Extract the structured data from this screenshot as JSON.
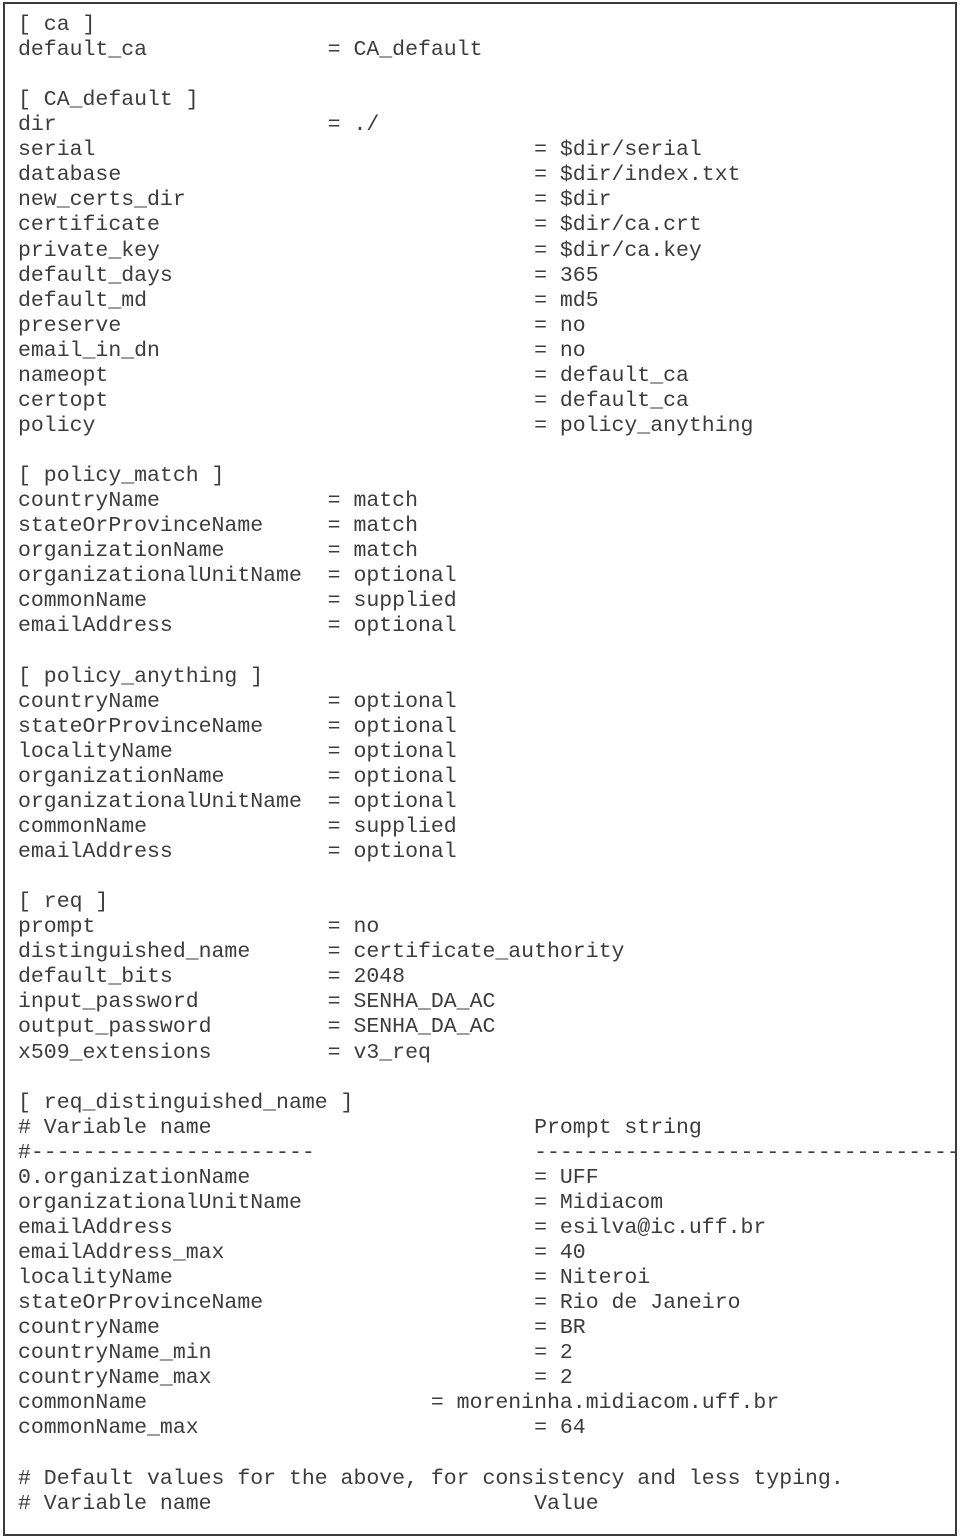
{
  "document": {
    "kind": "openssl-configuration-file-listing",
    "frame_border_color": "#3a3a3a",
    "text_color": "#3c3c3c",
    "background_color": "#ffffff",
    "font_style": "monospace",
    "char_columns": 64,
    "sections": [
      {
        "header": "[ ca ]",
        "entries": [
          {
            "key": "default_ca",
            "eq_column": 24,
            "value": "CA_default"
          }
        ]
      },
      {
        "header": "[ CA_default ]",
        "entries": [
          {
            "key": "dir",
            "eq_column": 24,
            "value": "./"
          },
          {
            "key": "serial",
            "eq_column": 40,
            "value": "$dir/serial"
          },
          {
            "key": "database",
            "eq_column": 40,
            "value": "$dir/index.txt"
          },
          {
            "key": "new_certs_dir",
            "eq_column": 40,
            "value": "$dir"
          },
          {
            "key": "certificate",
            "eq_column": 40,
            "value": "$dir/ca.crt"
          },
          {
            "key": "private_key",
            "eq_column": 40,
            "value": "$dir/ca.key"
          },
          {
            "key": "default_days",
            "eq_column": 40,
            "value": "365"
          },
          {
            "key": "default_md",
            "eq_column": 40,
            "value": "md5"
          },
          {
            "key": "preserve",
            "eq_column": 40,
            "value": "no"
          },
          {
            "key": "email_in_dn",
            "eq_column": 40,
            "value": "no"
          },
          {
            "key": "nameopt",
            "eq_column": 40,
            "value": "default_ca"
          },
          {
            "key": "certopt",
            "eq_column": 40,
            "value": "default_ca"
          },
          {
            "key": "policy",
            "eq_column": 40,
            "value": "policy_anything"
          }
        ]
      },
      {
        "header": "[ policy_match ]",
        "entries": [
          {
            "key": "countryName",
            "eq_column": 24,
            "value": "match"
          },
          {
            "key": "stateOrProvinceName",
            "eq_column": 24,
            "value": "match"
          },
          {
            "key": "organizationName",
            "eq_column": 24,
            "value": "match"
          },
          {
            "key": "organizationalUnitName",
            "eq_column": 24,
            "value": "optional"
          },
          {
            "key": "commonName",
            "eq_column": 24,
            "value": "supplied"
          },
          {
            "key": "emailAddress",
            "eq_column": 24,
            "value": "optional"
          }
        ]
      },
      {
        "header": "[ policy_anything ]",
        "entries": [
          {
            "key": "countryName",
            "eq_column": 24,
            "value": "optional"
          },
          {
            "key": "stateOrProvinceName",
            "eq_column": 24,
            "value": "optional"
          },
          {
            "key": "localityName",
            "eq_column": 24,
            "value": "optional"
          },
          {
            "key": "organizationName",
            "eq_column": 24,
            "value": "optional"
          },
          {
            "key": "organizationalUnitName",
            "eq_column": 24,
            "value": "optional"
          },
          {
            "key": "commonName",
            "eq_column": 24,
            "value": "supplied"
          },
          {
            "key": "emailAddress",
            "eq_column": 24,
            "value": "optional"
          }
        ]
      },
      {
        "header": "[ req ]",
        "entries": [
          {
            "key": "prompt",
            "eq_column": 24,
            "value": "no"
          },
          {
            "key": "distinguished_name",
            "eq_column": 24,
            "value": "certificate_authority"
          },
          {
            "key": "default_bits",
            "eq_column": 24,
            "value": "2048"
          },
          {
            "key": "input_password",
            "eq_column": 24,
            "value": "SENHA_DA_AC"
          },
          {
            "key": "output_password",
            "eq_column": 24,
            "value": "SENHA_DA_AC"
          },
          {
            "key": "x509_extensions",
            "eq_column": 24,
            "value": "v3_req"
          }
        ]
      },
      {
        "header": "[ req_distinguished_name ]",
        "column_headers": {
          "left": "# Variable name",
          "right": "Prompt string",
          "right_column": 40
        },
        "rule": {
          "left": "#----------------------",
          "right": "------------------------------------",
          "right_column": 40
        },
        "entries": [
          {
            "key": "0.organizationName",
            "eq_column": 40,
            "value": "UFF"
          },
          {
            "key": "organizationalUnitName",
            "eq_column": 40,
            "value": "Midiacom"
          },
          {
            "key": "emailAddress",
            "eq_column": 40,
            "value": "esilva@ic.uff.br"
          },
          {
            "key": "emailAddress_max",
            "eq_column": 40,
            "value": "40"
          },
          {
            "key": "localityName",
            "eq_column": 40,
            "value": "Niteroi"
          },
          {
            "key": "stateOrProvinceName",
            "eq_column": 40,
            "value": "Rio de Janeiro"
          },
          {
            "key": "countryName",
            "eq_column": 40,
            "value": "BR"
          },
          {
            "key": "countryName_min",
            "eq_column": 40,
            "value": "2"
          },
          {
            "key": "countryName_max",
            "eq_column": 40,
            "value": "2"
          },
          {
            "key": "commonName",
            "eq_column": 32,
            "value": "moreninha.midiacom.uff.br"
          },
          {
            "key": "commonName_max",
            "eq_column": 40,
            "value": "64"
          }
        ]
      }
    ],
    "trailing_comments": [
      {
        "text": "# Default values for the above, for consistency and less typing."
      },
      {
        "left": "# Variable name",
        "right": "Value",
        "right_column": 40
      }
    ]
  }
}
